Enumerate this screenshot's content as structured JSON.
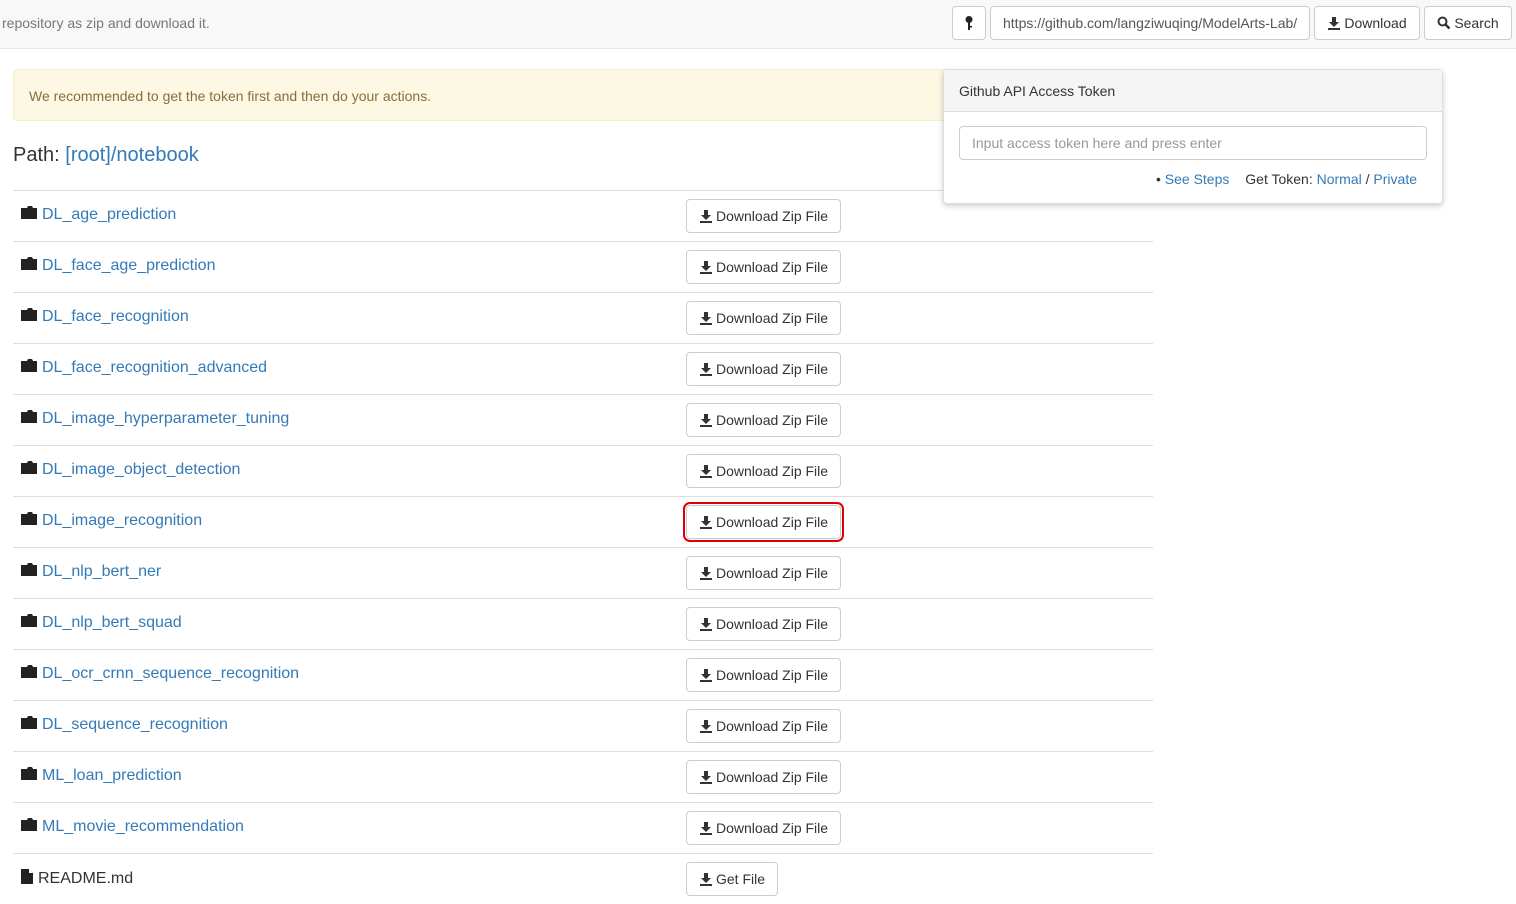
{
  "topbar": {
    "description": "repository as zip and download it.",
    "url_value": "https://github.com/langziwuqing/ModelArts-Lab/",
    "download_label": "Download",
    "search_label": "Search"
  },
  "alert": {
    "text": "We recommended to get the token first and then do your actions."
  },
  "path": {
    "label": "Path: ",
    "link": "[root]/notebook"
  },
  "token_panel": {
    "title": "Github API Access Token",
    "placeholder": "Input access token here and press enter",
    "see_steps": "See Steps",
    "get_token": "Get Token: ",
    "normal": "Normal",
    "separator": " / ",
    "private": "Private"
  },
  "rows": [
    {
      "name": "DL_age_prediction",
      "type": "folder",
      "action": "Download Zip File"
    },
    {
      "name": "DL_face_age_prediction",
      "type": "folder",
      "action": "Download Zip File"
    },
    {
      "name": "DL_face_recognition",
      "type": "folder",
      "action": "Download Zip File"
    },
    {
      "name": "DL_face_recognition_advanced",
      "type": "folder",
      "action": "Download Zip File"
    },
    {
      "name": "DL_image_hyperparameter_tuning",
      "type": "folder",
      "action": "Download Zip File"
    },
    {
      "name": "DL_image_object_detection",
      "type": "folder",
      "action": "Download Zip File"
    },
    {
      "name": "DL_image_recognition",
      "type": "folder",
      "action": "Download Zip File",
      "highlighted": true
    },
    {
      "name": "DL_nlp_bert_ner",
      "type": "folder",
      "action": "Download Zip File"
    },
    {
      "name": "DL_nlp_bert_squad",
      "type": "folder",
      "action": "Download Zip File"
    },
    {
      "name": "DL_ocr_crnn_sequence_recognition",
      "type": "folder",
      "action": "Download Zip File"
    },
    {
      "name": "DL_sequence_recognition",
      "type": "folder",
      "action": "Download Zip File"
    },
    {
      "name": "ML_loan_prediction",
      "type": "folder",
      "action": "Download Zip File"
    },
    {
      "name": "ML_movie_recommendation",
      "type": "folder",
      "action": "Download Zip File"
    },
    {
      "name": "README.md",
      "type": "file",
      "action": "Get File"
    }
  ],
  "colors": {
    "link": "#337ab7",
    "highlight": "#dd0000",
    "alert_bg": "#fcf8e3"
  }
}
